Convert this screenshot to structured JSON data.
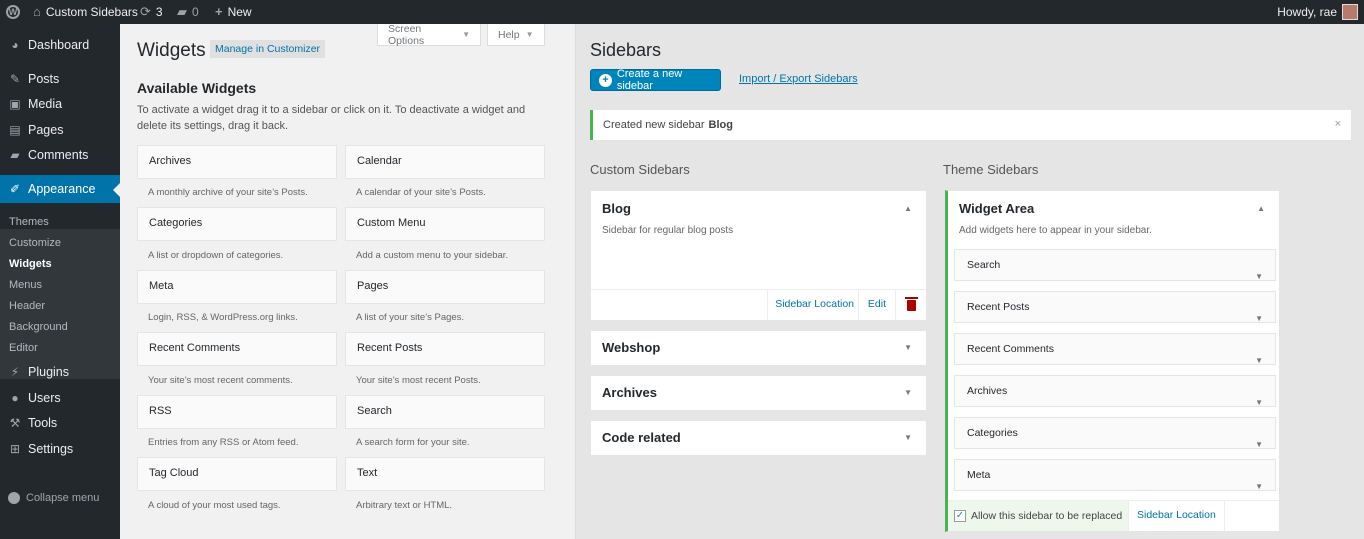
{
  "adminbar": {
    "site_name": "Custom Sidebars",
    "updates_count": "3",
    "comments_count": "0",
    "new_label": "New",
    "howdy": "Howdy, rae"
  },
  "menu": {
    "dashboard": "Dashboard",
    "posts": "Posts",
    "media": "Media",
    "pages": "Pages",
    "comments": "Comments",
    "appearance": "Appearance",
    "submenu": [
      "Themes",
      "Customize",
      "Widgets",
      "Menus",
      "Header",
      "Background",
      "Editor"
    ],
    "plugins": "Plugins",
    "users": "Users",
    "tools": "Tools",
    "settings": "Settings",
    "collapse": "Collapse menu"
  },
  "widgets_page": {
    "title": "Widgets",
    "manage_customizer": "Manage in Customizer",
    "screen_options": "Screen Options",
    "help": "Help",
    "available_title": "Available Widgets",
    "available_desc": "To activate a widget drag it to a sidebar or click on it. To deactivate a widget and delete its settings, drag it back.",
    "widgets": [
      {
        "name": "Archives",
        "desc": "A monthly archive of your site’s Posts."
      },
      {
        "name": "Calendar",
        "desc": "A calendar of your site’s Posts."
      },
      {
        "name": "Categories",
        "desc": "A list or dropdown of categories."
      },
      {
        "name": "Custom Menu",
        "desc": "Add a custom menu to your sidebar."
      },
      {
        "name": "Meta",
        "desc": "Login, RSS, & WordPress.org links."
      },
      {
        "name": "Pages",
        "desc": "A list of your site’s Pages."
      },
      {
        "name": "Recent Comments",
        "desc": "Your site’s most recent comments."
      },
      {
        "name": "Recent Posts",
        "desc": "Your site’s most recent Posts."
      },
      {
        "name": "RSS",
        "desc": "Entries from any RSS or Atom feed."
      },
      {
        "name": "Search",
        "desc": "A search form for your site."
      },
      {
        "name": "Tag Cloud",
        "desc": "A cloud of your most used tags."
      },
      {
        "name": "Text",
        "desc": "Arbitrary text or HTML."
      }
    ]
  },
  "sidebars_page": {
    "title": "Sidebars",
    "create_button": "Create a new sidebar",
    "import_export": "Import / Export Sidebars",
    "notice_text": "Created new sidebar",
    "notice_name": "Blog",
    "notice_close": "×",
    "custom_heading": "Custom Sidebars",
    "theme_heading": "Theme Sidebars",
    "custom_sidebars": [
      {
        "title": "Blog",
        "desc": "Sidebar for regular blog posts"
      },
      {
        "title": "Webshop"
      },
      {
        "title": "Archives"
      },
      {
        "title": "Code related"
      }
    ],
    "sidebar_location": "Sidebar Location",
    "edit": "Edit",
    "widget_area": {
      "title": "Widget Area",
      "desc": "Add widgets here to appear in your sidebar.",
      "widgets": [
        "Search",
        "Recent Posts",
        "Recent Comments",
        "Archives",
        "Categories",
        "Meta"
      ],
      "allow_replace": "Allow this sidebar to be replaced",
      "location": "Sidebar Location"
    }
  }
}
